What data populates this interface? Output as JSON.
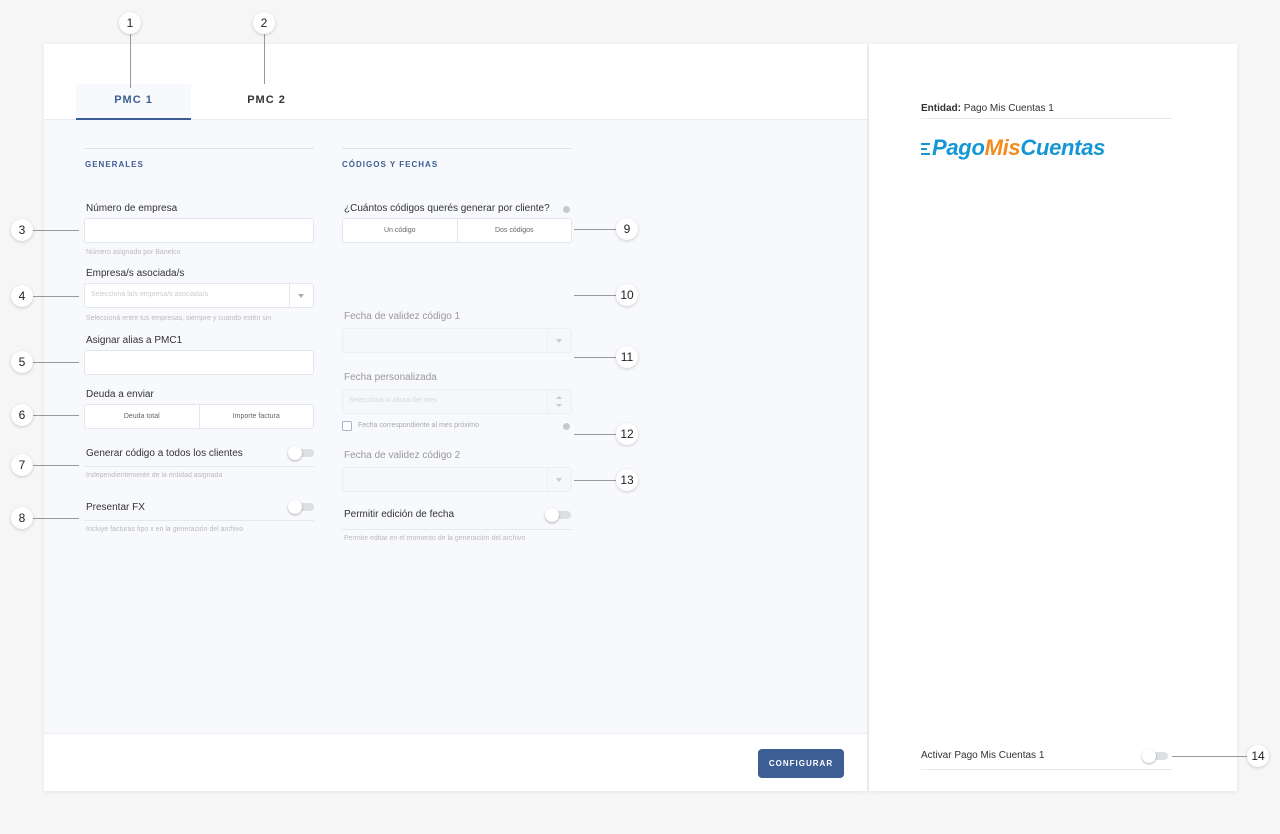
{
  "tabs": [
    {
      "label": "PMC 1",
      "active": true
    },
    {
      "label": "PMC 2",
      "active": false
    }
  ],
  "sections": {
    "generales": "GENERALES",
    "codigos": "CÓDIGOS Y FECHAS"
  },
  "form": {
    "numero_empresa": {
      "label": "Número de empresa",
      "value": "",
      "help": "Número asignado por Banelco"
    },
    "empresas_asociadas": {
      "label": "Empresa/s asociada/s",
      "placeholder": "Seleccioná la/s empresa/s asociada/s",
      "help": "Seleccioná entre tus empresas, siempre y cuando estén sin"
    },
    "alias": {
      "label": "Asignar alias a PMC1",
      "value": ""
    },
    "deuda": {
      "label": "Deuda a enviar",
      "options": [
        "Deuda total",
        "Importe factura"
      ]
    },
    "generar_codigo": {
      "label": "Generar código a todos los clientes",
      "help": "Independientemente de la entidad asignada",
      "on": false
    },
    "presentar_fx": {
      "label": "Presentar FX",
      "help": "Incluye facturas tipo x en la generación del archivo",
      "on": false
    },
    "cuantos_codigos": {
      "label": "¿Cuántos códigos querés generar por cliente?",
      "options": [
        "Un código",
        "Dos códigos"
      ]
    },
    "fecha_validez_1": {
      "label": "Fecha de validez código 1",
      "value": ""
    },
    "fecha_personalizada": {
      "label": "Fecha personalizada",
      "placeholder": "Seleccioná la altura del mes"
    },
    "mes_proximo": {
      "label": "Fecha correspondiente al mes próximo",
      "checked": false
    },
    "fecha_validez_2": {
      "label": "Fecha de validez código 2",
      "value": ""
    },
    "permitir_edicion": {
      "label": "Permitir edición de fecha",
      "help": "Permite editar en el momento de la generación del archivo",
      "on": false
    }
  },
  "footer": {
    "configurar": "CONFIGURAR"
  },
  "right": {
    "entity_label": "Entidad:",
    "entity_name": "Pago Mis Cuentas 1",
    "logo_part1": "Pago",
    "logo_part2": "Mis",
    "logo_part3": "Cuentas",
    "activate_label": "Activar Pago Mis Cuentas 1",
    "activate_on": false
  },
  "annotations": [
    "1",
    "2",
    "3",
    "4",
    "5",
    "6",
    "7",
    "8",
    "9",
    "10",
    "11",
    "12",
    "13",
    "14"
  ],
  "colors": {
    "accent": "#3c5e95",
    "logo_blue": "#1497d4",
    "logo_orange": "#f28c1e"
  }
}
